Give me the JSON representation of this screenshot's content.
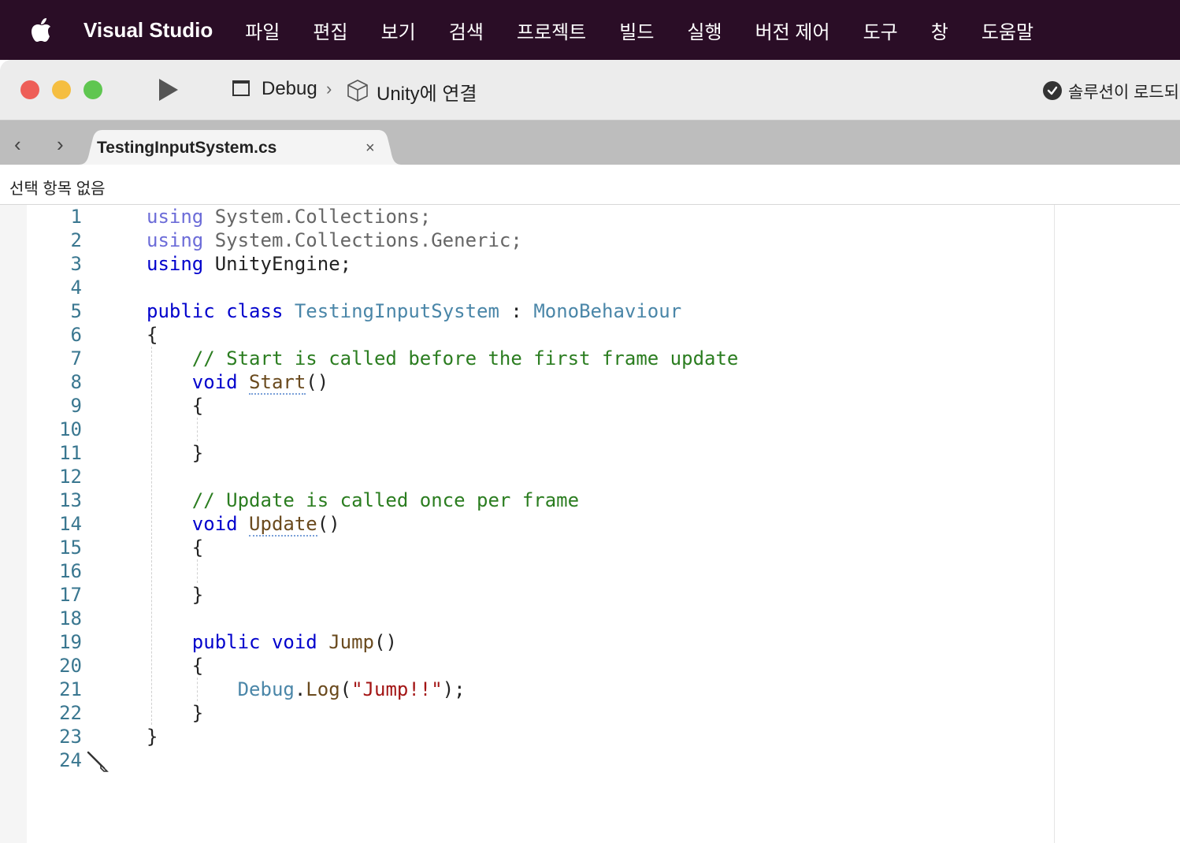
{
  "menubar": {
    "app_name": "Visual Studio",
    "items": [
      "파일",
      "편집",
      "보기",
      "검색",
      "프로젝트",
      "빌드",
      "실행",
      "버전 제어",
      "도구",
      "창",
      "도움말"
    ]
  },
  "toolbar": {
    "configuration": "Debug",
    "target": "Unity에 연결",
    "status": "솔루션이 로드되"
  },
  "tabs": [
    {
      "title": "TestingInputSystem.cs",
      "close": "×"
    }
  ],
  "navbar": {
    "selection": "선택 항목 없음"
  },
  "editor": {
    "line_numbers": [
      "1",
      "2",
      "3",
      "4",
      "5",
      "6",
      "7",
      "8",
      "9",
      "10",
      "11",
      "12",
      "13",
      "14",
      "15",
      "16",
      "17",
      "18",
      "19",
      "20",
      "21",
      "22",
      "23",
      "24"
    ],
    "lines": [
      [
        {
          "t": "using",
          "c": "kw-dim"
        },
        {
          "t": " System.Collections;",
          "c": "ns-dim"
        }
      ],
      [
        {
          "t": "using",
          "c": "kw-dim"
        },
        {
          "t": " System.Collections.Generic;",
          "c": "ns-dim"
        }
      ],
      [
        {
          "t": "using",
          "c": "kw"
        },
        {
          "t": " UnityEngine;",
          "c": "plain"
        }
      ],
      [],
      [
        {
          "t": "public",
          "c": "kw"
        },
        {
          "t": " ",
          "c": "plain"
        },
        {
          "t": "class",
          "c": "kw"
        },
        {
          "t": " ",
          "c": "plain"
        },
        {
          "t": "TestingInputSystem",
          "c": "type"
        },
        {
          "t": " : ",
          "c": "plain"
        },
        {
          "t": "MonoBehaviour",
          "c": "type"
        }
      ],
      [
        {
          "t": "{",
          "c": "plain"
        }
      ],
      [
        {
          "t": "    // Start is called before the first frame update",
          "c": "comment"
        }
      ],
      [
        {
          "t": "    ",
          "c": "plain"
        },
        {
          "t": "void",
          "c": "kw"
        },
        {
          "t": " ",
          "c": "plain"
        },
        {
          "t": "Start",
          "c": "method squig"
        },
        {
          "t": "()",
          "c": "plain"
        }
      ],
      [
        {
          "t": "    {",
          "c": "plain"
        }
      ],
      [],
      [
        {
          "t": "    }",
          "c": "plain"
        }
      ],
      [],
      [
        {
          "t": "    // Update is called once per frame",
          "c": "comment"
        }
      ],
      [
        {
          "t": "    ",
          "c": "plain"
        },
        {
          "t": "void",
          "c": "kw"
        },
        {
          "t": " ",
          "c": "plain"
        },
        {
          "t": "Update",
          "c": "method squig"
        },
        {
          "t": "()",
          "c": "plain"
        }
      ],
      [
        {
          "t": "    {",
          "c": "plain"
        }
      ],
      [],
      [
        {
          "t": "    }",
          "c": "plain"
        }
      ],
      [],
      [
        {
          "t": "    ",
          "c": "plain"
        },
        {
          "t": "public",
          "c": "kw"
        },
        {
          "t": " ",
          "c": "plain"
        },
        {
          "t": "void",
          "c": "kw"
        },
        {
          "t": " ",
          "c": "plain"
        },
        {
          "t": "Jump",
          "c": "method"
        },
        {
          "t": "()",
          "c": "plain"
        }
      ],
      [
        {
          "t": "    {",
          "c": "plain"
        }
      ],
      [
        {
          "t": "        ",
          "c": "plain"
        },
        {
          "t": "Debug",
          "c": "type"
        },
        {
          "t": ".",
          "c": "plain"
        },
        {
          "t": "Log",
          "c": "method"
        },
        {
          "t": "(",
          "c": "plain"
        },
        {
          "t": "\"Jump!!\"",
          "c": "string"
        },
        {
          "t": ");",
          "c": "plain"
        }
      ],
      [
        {
          "t": "    }",
          "c": "plain"
        }
      ],
      [
        {
          "t": "}",
          "c": "plain"
        }
      ],
      []
    ]
  },
  "colors": {
    "menubar_bg": "#2a0d26",
    "keyword": "#0000cc",
    "type": "#4a86a8",
    "comment": "#2b7d20",
    "string": "#a31515",
    "line_number": "#3a7790"
  }
}
